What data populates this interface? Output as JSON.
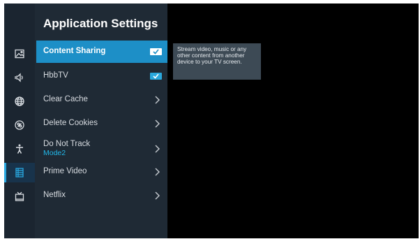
{
  "panel": {
    "title": "Application Settings"
  },
  "rail": {
    "icons": [
      "picture-icon",
      "sound-icon",
      "network-icon",
      "general-icon",
      "accessibility-icon",
      "apps-icon",
      "tv-icon"
    ],
    "active_index": 5
  },
  "menu": {
    "items": [
      {
        "label": "Content Sharing",
        "control": "toggle",
        "state": "on"
      },
      {
        "label": "HbbTV",
        "control": "toggle",
        "state": "on"
      },
      {
        "label": "Clear Cache",
        "control": "chevron"
      },
      {
        "label": "Delete Cookies",
        "control": "chevron"
      },
      {
        "label": "Do Not Track",
        "value": "Mode2",
        "control": "chevron"
      },
      {
        "label": "Prime Video",
        "control": "chevron"
      },
      {
        "label": "Netflix",
        "control": "chevron"
      }
    ],
    "focused_index": 0
  },
  "tooltip": {
    "text": "Stream video, music or any other content from another device to your TV screen."
  },
  "colors": {
    "accent": "#1d8fc7",
    "panel_bg": "#1f2a35",
    "rail_bg": "#1b2530",
    "value_text": "#22b7e8"
  }
}
